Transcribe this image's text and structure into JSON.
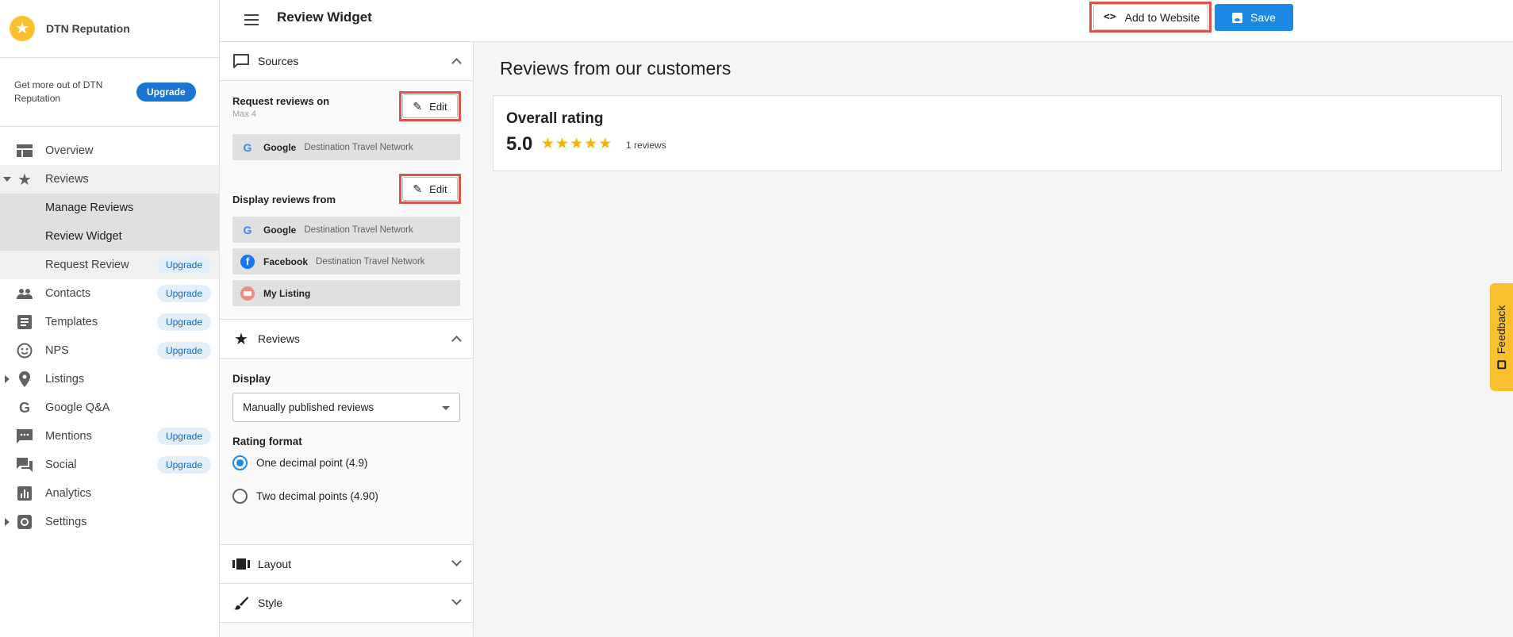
{
  "brand": {
    "name": "DTN Reputation",
    "logo_icon": "star"
  },
  "promo": {
    "text": "Get more out of DTN Reputation",
    "button": "Upgrade"
  },
  "nav": {
    "overview": "Overview",
    "reviews": "Reviews",
    "manage_reviews": "Manage Reviews",
    "review_widget": "Review Widget",
    "request_review": "Request Review",
    "contacts": "Contacts",
    "templates": "Templates",
    "nps": "NPS",
    "listings": "Listings",
    "google_qa": "Google Q&A",
    "mentions": "Mentions",
    "social": "Social",
    "analytics": "Analytics",
    "settings": "Settings",
    "upgrade_badge": "Upgrade"
  },
  "topbar": {
    "title": "Review Widget",
    "add_to_website": "Add to Website",
    "save": "Save"
  },
  "panel": {
    "sources": "Sources",
    "request_reviews_on": "Request reviews on",
    "max": "Max 4",
    "edit": "Edit",
    "display_reviews_from": "Display reviews from",
    "request_sources": [
      {
        "name": "Google",
        "business": "Destination Travel Network"
      }
    ],
    "display_sources": [
      {
        "name": "Google",
        "business": "Destination Travel Network"
      },
      {
        "name": "Facebook",
        "business": "Destination Travel Network"
      },
      {
        "name": "My Listing",
        "business": ""
      }
    ],
    "reviews": "Reviews",
    "display_label": "Display",
    "display_value": "Manually published reviews",
    "rating_format": "Rating format",
    "rating_options": [
      "One decimal point (4.9)",
      "Two decimal points (4.90)"
    ],
    "rating_selected": 0,
    "layout": "Layout",
    "style": "Style"
  },
  "preview": {
    "heading": "Reviews from our customers",
    "card_title": "Overall rating",
    "score": "5.0",
    "stars": 5,
    "count": "1 reviews"
  },
  "feedback": "Feedback",
  "colors": {
    "primary": "#1e88e5",
    "star": "#f5b400",
    "highlight": "#d9534f",
    "feedback": "#fbc02d"
  }
}
